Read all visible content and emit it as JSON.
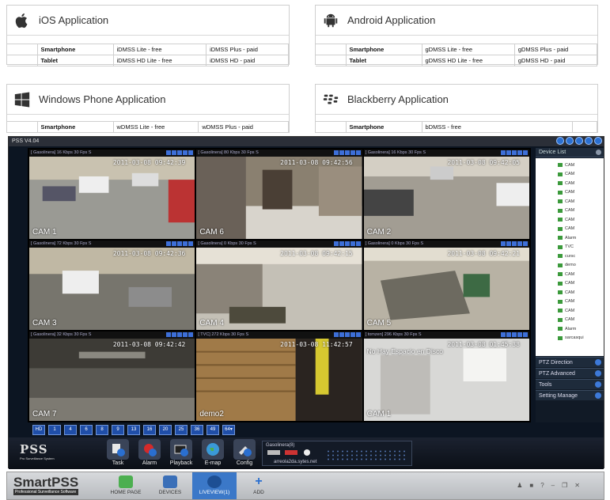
{
  "apps": {
    "ios": {
      "title": "iOS Application",
      "rows": [
        [
          "Smartphone",
          "iDMSS Lite - free",
          "iDMSS Plus - paid"
        ],
        [
          "Tablet",
          "iDMSS HD Lite - free",
          "iDMSS HD - paid"
        ]
      ]
    },
    "android": {
      "title": "Android Application",
      "rows": [
        [
          "Smartphone",
          "gDMSS Lite - free",
          "gDMSS Plus - paid"
        ],
        [
          "Tablet",
          "gDMSS HD Lite - free",
          "gDMSS HD - paid"
        ]
      ]
    },
    "windows": {
      "title": "Windows Phone Application",
      "rows": [
        [
          "Smartphone",
          "wDMSS Lite - free",
          "wDMSS Plus - paid"
        ]
      ]
    },
    "blackberry": {
      "title": "Blackberry Application",
      "rows": [
        [
          "Smartphone",
          "bDMSS - free",
          ""
        ]
      ]
    }
  },
  "pss": {
    "title": "PSS  V4.04",
    "cells": [
      {
        "info": "[ Gasolinera] 16 Kbps 30 Fps S",
        "timestamp": "2011-03-08 09:42:39",
        "cam": "CAM 1",
        "scene": "lot"
      },
      {
        "info": "[ Gasolinera] 80 Kbps 30 Fps S",
        "timestamp": "2011-03-08 09:42:56",
        "cam": "CAM 6",
        "scene": "room"
      },
      {
        "info": "[ Gasolinera] 16 Kbps 30 Fps S",
        "timestamp": "2011-03-08 09:42:05",
        "cam": "CAM 2",
        "scene": "lot2"
      },
      {
        "info": "[ Gasolinera] 72 Kbps 30 Fps S",
        "timestamp": "2011-03-08 09:42:36",
        "cam": "CAM 3",
        "scene": "street"
      },
      {
        "info": "[ Gasolinera] 0 Kbps 30 Fps S",
        "timestamp": "2011-03-08 09:42:15",
        "cam": "CAM 4",
        "scene": "yard"
      },
      {
        "info": "[ Gasolinera] 0 Kbps 30 Fps S",
        "timestamp": "2011-03-08 09:42:21",
        "cam": "CAM 5",
        "scene": "roof"
      },
      {
        "info": "[ Gasolinera] 32 Kbps 30 Fps S",
        "timestamp": "2011-03-08 09:42:42",
        "cam": "CAM 7",
        "scene": "dark"
      },
      {
        "info": "[ TVC] 272 Kbps 30 Fps S",
        "timestamp": "2011-03-08 11:42:57",
        "cam": "demo2",
        "scene": "door"
      },
      {
        "info": "[ tomzen] 296 Kbps 30 Fps S",
        "timestamp": "2011-03-08 01:45:38",
        "cam": "CAM 1",
        "scene": "white",
        "overlay": "No Hay Espacio en Disco"
      }
    ],
    "sidebar": {
      "device_list": "Device List",
      "tree": [
        "CAM",
        "CAM",
        "CAM",
        "CAM",
        "CAM",
        "CAM",
        "CAM",
        "CAM",
        "Alarm",
        "TVC",
        "cursc",
        "demo",
        "CAM",
        "CAM",
        "CAM",
        "CAM",
        "CAM",
        "CAM",
        "Alarm",
        "sarcasqui"
      ],
      "panels": [
        "PTZ Direction",
        "PTZ Advanced",
        "Tools",
        "Setting Manage"
      ]
    },
    "layouts": [
      "HD",
      "1",
      "4",
      "6",
      "8",
      "9",
      "13",
      "16",
      "20",
      "25",
      "36",
      "49",
      "64▾"
    ],
    "logo": "PSS",
    "logo_sub": "Pro Surveillance System",
    "tools": [
      "Task",
      "Alarm",
      "Playback",
      "E-map",
      "Config"
    ],
    "device_box": {
      "name": "Gasolinera(8)",
      "host": "arreola2da.sytes.net"
    }
  },
  "smartpss": {
    "brand": "SmartPSS",
    "brand_sub": "Professional Surveillance Software",
    "tabs": [
      "HOME PAGE",
      "DEVICES",
      "LIVEVIEW(1)",
      "ADD"
    ],
    "active_tab": "LIVEVIEW(1)",
    "sys_icons": [
      "user-icon",
      "lock-icon",
      "help-icon",
      "minimize-icon",
      "restore-icon",
      "close-icon"
    ]
  },
  "colors": {
    "accent": "#2a6fd0",
    "pss_bg": "#0c1522",
    "smart_active": "#3b78c8"
  }
}
